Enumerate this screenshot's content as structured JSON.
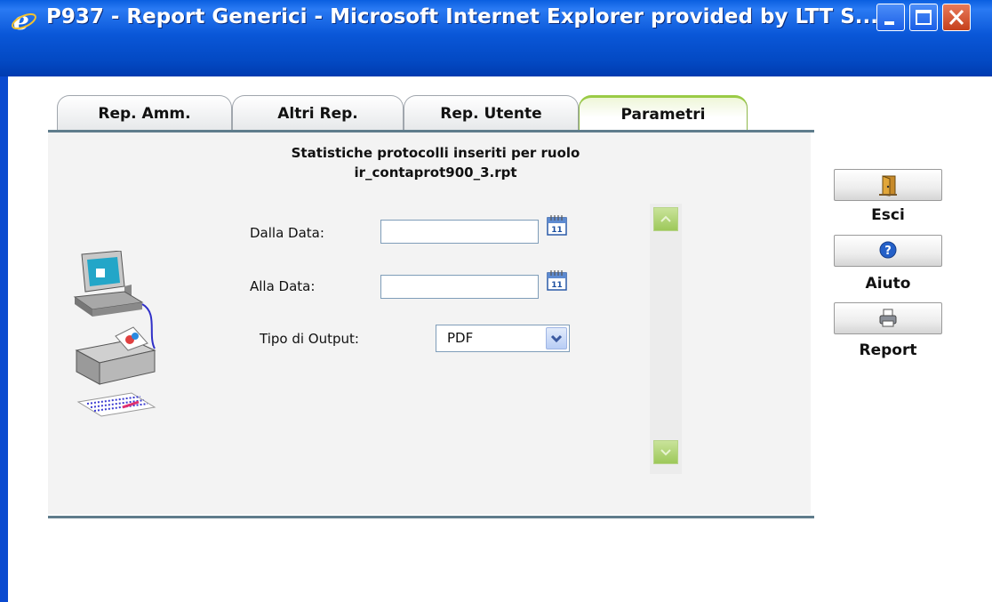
{
  "window": {
    "title": "P937 - Report Generici - Microsoft Internet Explorer provided by LTT S...."
  },
  "tabs": [
    {
      "label": "Rep. Amm.",
      "active": false
    },
    {
      "label": "Altri Rep.",
      "active": false
    },
    {
      "label": "Rep. Utente",
      "active": false
    },
    {
      "label": "Parametri",
      "active": true
    }
  ],
  "report": {
    "title": "Statistiche protocolli inseriti per ruolo",
    "file": "ir_contaprot900_3.rpt"
  },
  "form": {
    "dalla_data_label": "Dalla Data:",
    "dalla_data_value": "",
    "alla_data_label": "Alla Data:",
    "alla_data_value": "",
    "calendar_icon_text": "11",
    "tipo_output_label": "Tipo di Output:",
    "tipo_output_value": "PDF"
  },
  "actions": {
    "esci_label": "Esci",
    "aiuto_label": "Aiuto",
    "report_label": "Report"
  },
  "icons": {
    "browser": "ie-icon",
    "calendar": "calendar-icon",
    "exit": "door-exit-icon",
    "help": "help-icon",
    "print": "printer-icon",
    "illustration": "computer-printer-illustration"
  },
  "colors": {
    "titlebar": "#0a57d8",
    "active_tab_accent": "#9acb46",
    "panel_bg": "#f3f3f3",
    "panel_border": "#5f7c8c",
    "scroll_button": "#9dc85a"
  }
}
